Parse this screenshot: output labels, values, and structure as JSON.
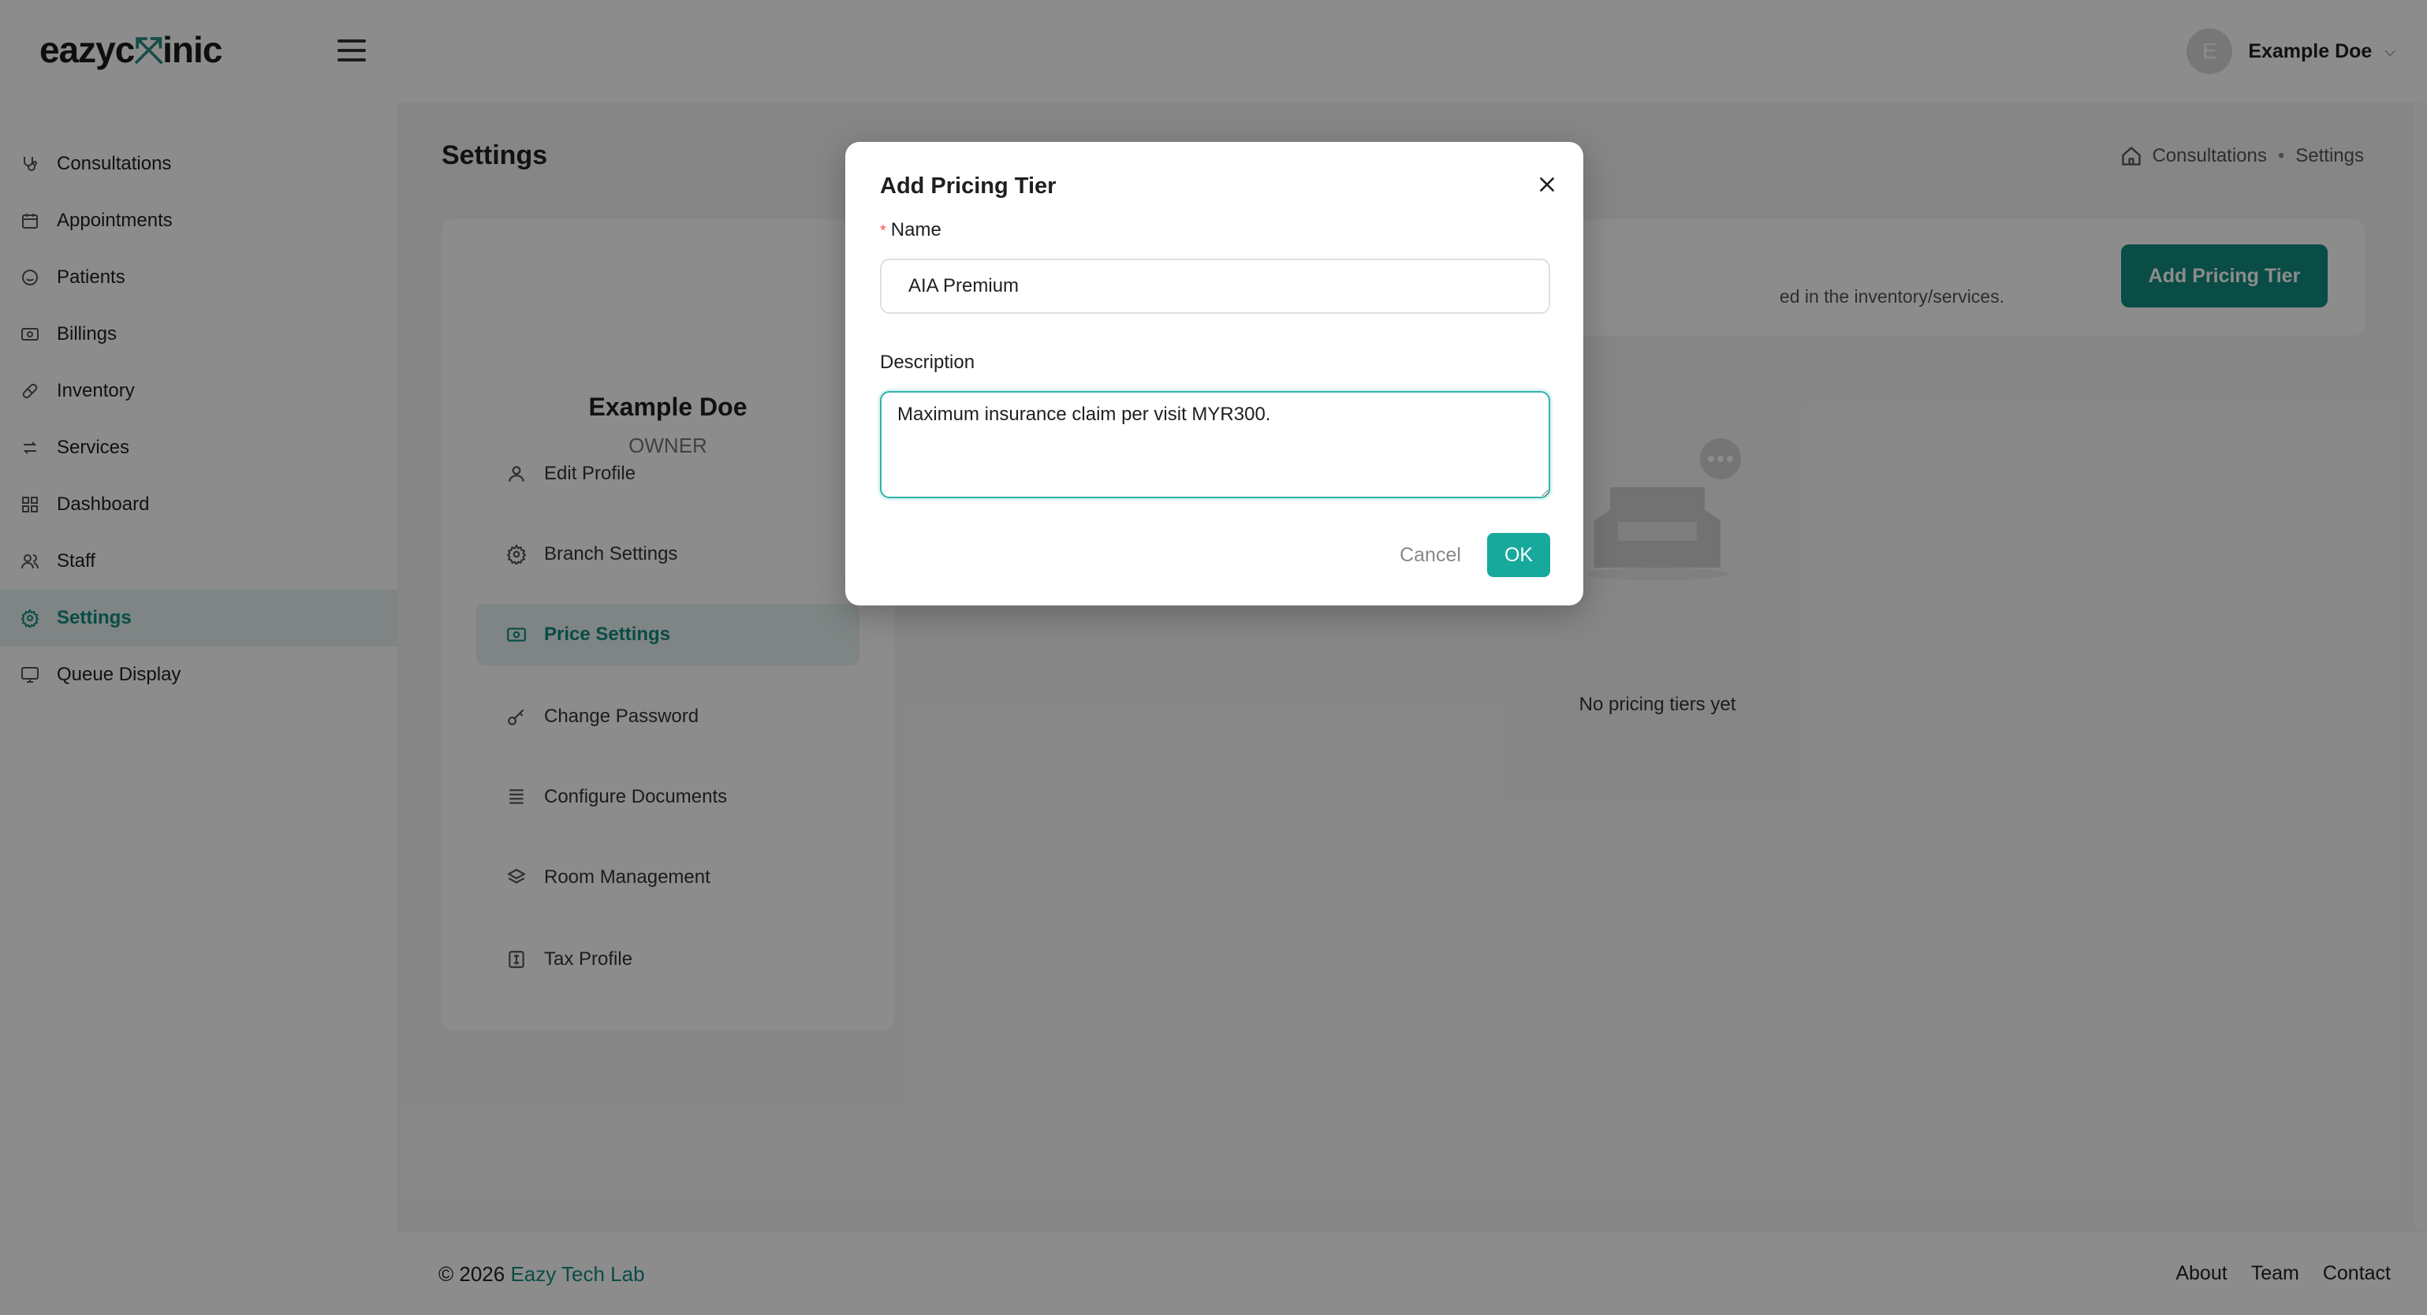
{
  "brand": {
    "logo_prefix": "eazyc",
    "logo_mark": "⤧",
    "logo_suffix": "inic",
    "accent": "#138a80"
  },
  "header": {
    "user_initial": "E",
    "user_name": "Example Doe"
  },
  "sidebar": {
    "items": [
      {
        "label": "Consultations",
        "icon": "stethoscope-icon"
      },
      {
        "label": "Appointments",
        "icon": "calendar-icon"
      },
      {
        "label": "Patients",
        "icon": "smiley-icon"
      },
      {
        "label": "Billings",
        "icon": "money-icon"
      },
      {
        "label": "Inventory",
        "icon": "pill-icon"
      },
      {
        "label": "Services",
        "icon": "swap-icon"
      },
      {
        "label": "Dashboard",
        "icon": "dashboard-icon"
      },
      {
        "label": "Staff",
        "icon": "users-icon"
      },
      {
        "label": "Settings",
        "icon": "gear-icon",
        "active": true
      },
      {
        "label": "Queue Display",
        "icon": "monitor-icon"
      }
    ]
  },
  "page": {
    "title": "Settings",
    "breadcrumb": [
      "Consultations",
      "Settings"
    ],
    "breadcrumb_separator": "•"
  },
  "profile": {
    "name": "Example Doe",
    "role": "OWNER",
    "menu": [
      {
        "label": "Edit Profile",
        "icon": "user-icon"
      },
      {
        "label": "Branch Settings",
        "icon": "gear-icon"
      },
      {
        "label": "Price Settings",
        "icon": "money-icon",
        "active": true
      },
      {
        "label": "Change Password",
        "icon": "key-icon"
      },
      {
        "label": "Configure Documents",
        "icon": "document-lines-icon"
      },
      {
        "label": "Room Management",
        "icon": "layers-icon"
      },
      {
        "label": "Tax Profile",
        "icon": "tax-icon"
      }
    ]
  },
  "pricing": {
    "description_visible": "ed in the inventory/services.",
    "add_button": "Add Pricing Tier",
    "empty_text": "No pricing tiers yet"
  },
  "modal": {
    "title": "Add Pricing Tier",
    "name_label": "Name",
    "required_mark": "*",
    "name_value": "AIA Premium",
    "description_label": "Description",
    "description_value": "Maximum insurance claim per visit MYR300.",
    "cancel": "Cancel",
    "ok": "OK"
  },
  "footer": {
    "copyright_prefix": "© 2026",
    "company": "Eazy Tech Lab",
    "links": [
      "About",
      "Team",
      "Contact"
    ]
  }
}
